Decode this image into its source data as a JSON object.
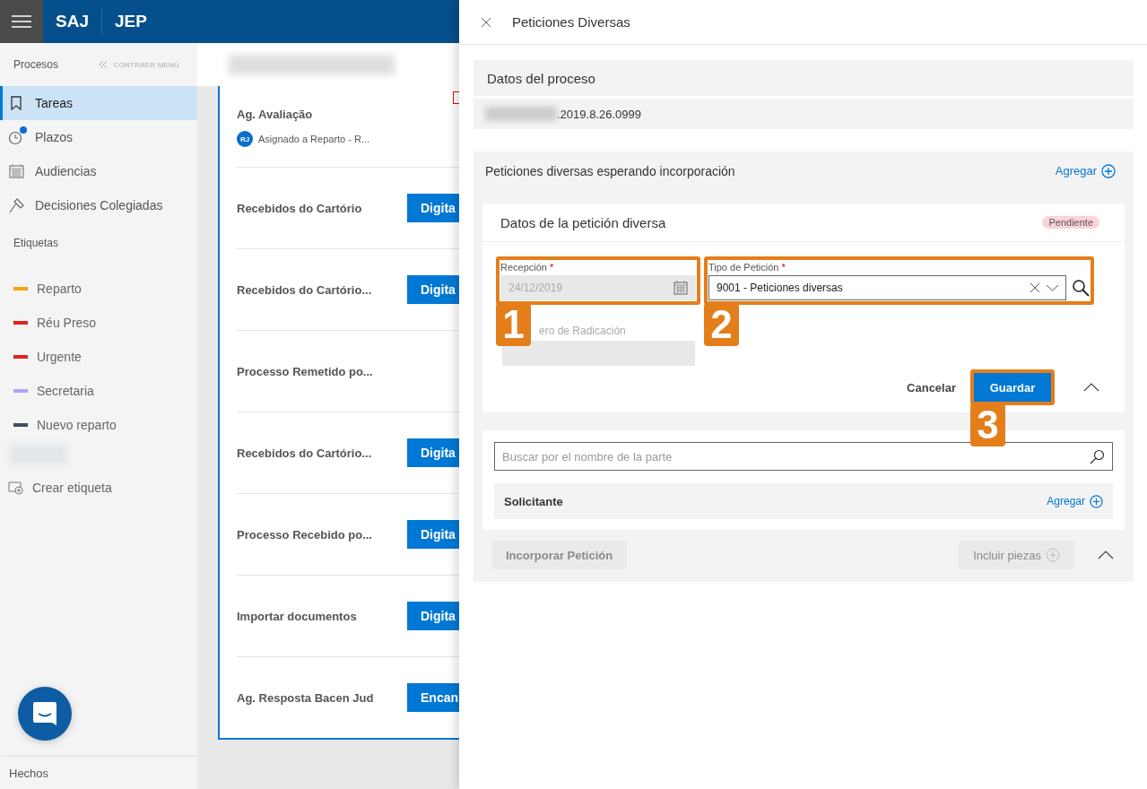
{
  "header": {
    "logos": [
      "SAJ",
      "JEP"
    ]
  },
  "sidebar": {
    "section_title": "Procesos",
    "collapse": "CONTRAER MENÚ",
    "items": [
      {
        "label": "Tareas",
        "selected": true,
        "notification": false
      },
      {
        "label": "Plazos",
        "selected": false,
        "notification": true
      },
      {
        "label": "Audiencias",
        "selected": false,
        "notification": false
      },
      {
        "label": "Decisiones Colegiadas",
        "selected": false,
        "notification": false
      }
    ],
    "tags_title": "Etiquetas",
    "tags": [
      {
        "label": "Reparto",
        "color": "#f7a30d"
      },
      {
        "label": "Réu Preso",
        "color": "#e0241b"
      },
      {
        "label": "Urgente",
        "color": "#e0241b"
      },
      {
        "label": "Secretaria",
        "color": "#b4a0f5"
      },
      {
        "label": "Nuevo reparto",
        "color": "#3c4f63"
      }
    ],
    "create_tag": "Crear etiqueta",
    "footer": "Hechos"
  },
  "tasks": [
    {
      "title": "Ag. Avaliação",
      "avatar": "RJ",
      "assigned": "Asignado a Reparto - R..."
    },
    {
      "title": "Recebidos do Cartório",
      "action": "Digita"
    },
    {
      "title": "Recebidos do Cartório...",
      "action": "Digita"
    },
    {
      "title": "Processo Remetido po..."
    },
    {
      "title": "Recebidos do Cartório...",
      "action": "Digita"
    },
    {
      "title": "Processo Recebido po...",
      "action": "Digita"
    },
    {
      "title": "Importar documentos",
      "action": "Digita"
    },
    {
      "title": "Ag. Resposta Bacen Jud",
      "action": "Encan"
    }
  ],
  "panel": {
    "title": "Peticiones Diversas",
    "process_section": {
      "title": "Datos del proceso",
      "number": ".2019.8.26.0999"
    },
    "pending_section": {
      "title": "Peticiones diversas esperando incorporación",
      "add": "Agregar"
    },
    "petition": {
      "title": "Datos de la petición diversa",
      "status": "Pendiente",
      "fields": [
        {
          "label": "Recepción",
          "required_mark": "*",
          "value": "24/12/2019",
          "disabled": true,
          "step": "1"
        },
        {
          "label": "Tipo de Petición",
          "required_mark": "*",
          "value": "9001 - Peticiones diversas",
          "disabled": false,
          "step": "2"
        }
      ],
      "radicacion_label": "ero de Radicación",
      "cancel": "Cancelar",
      "save": "Guardar",
      "save_step": "3"
    },
    "party_search": {
      "placeholder": "Buscar por el nombre de la parte"
    },
    "solicitante": {
      "title": "Solicitante",
      "add": "Agregar"
    },
    "footer_buttons": [
      {
        "label": "Incorporar Petición",
        "disabled": true
      },
      {
        "label": "Incluir piezas",
        "disabled": true
      }
    ]
  }
}
